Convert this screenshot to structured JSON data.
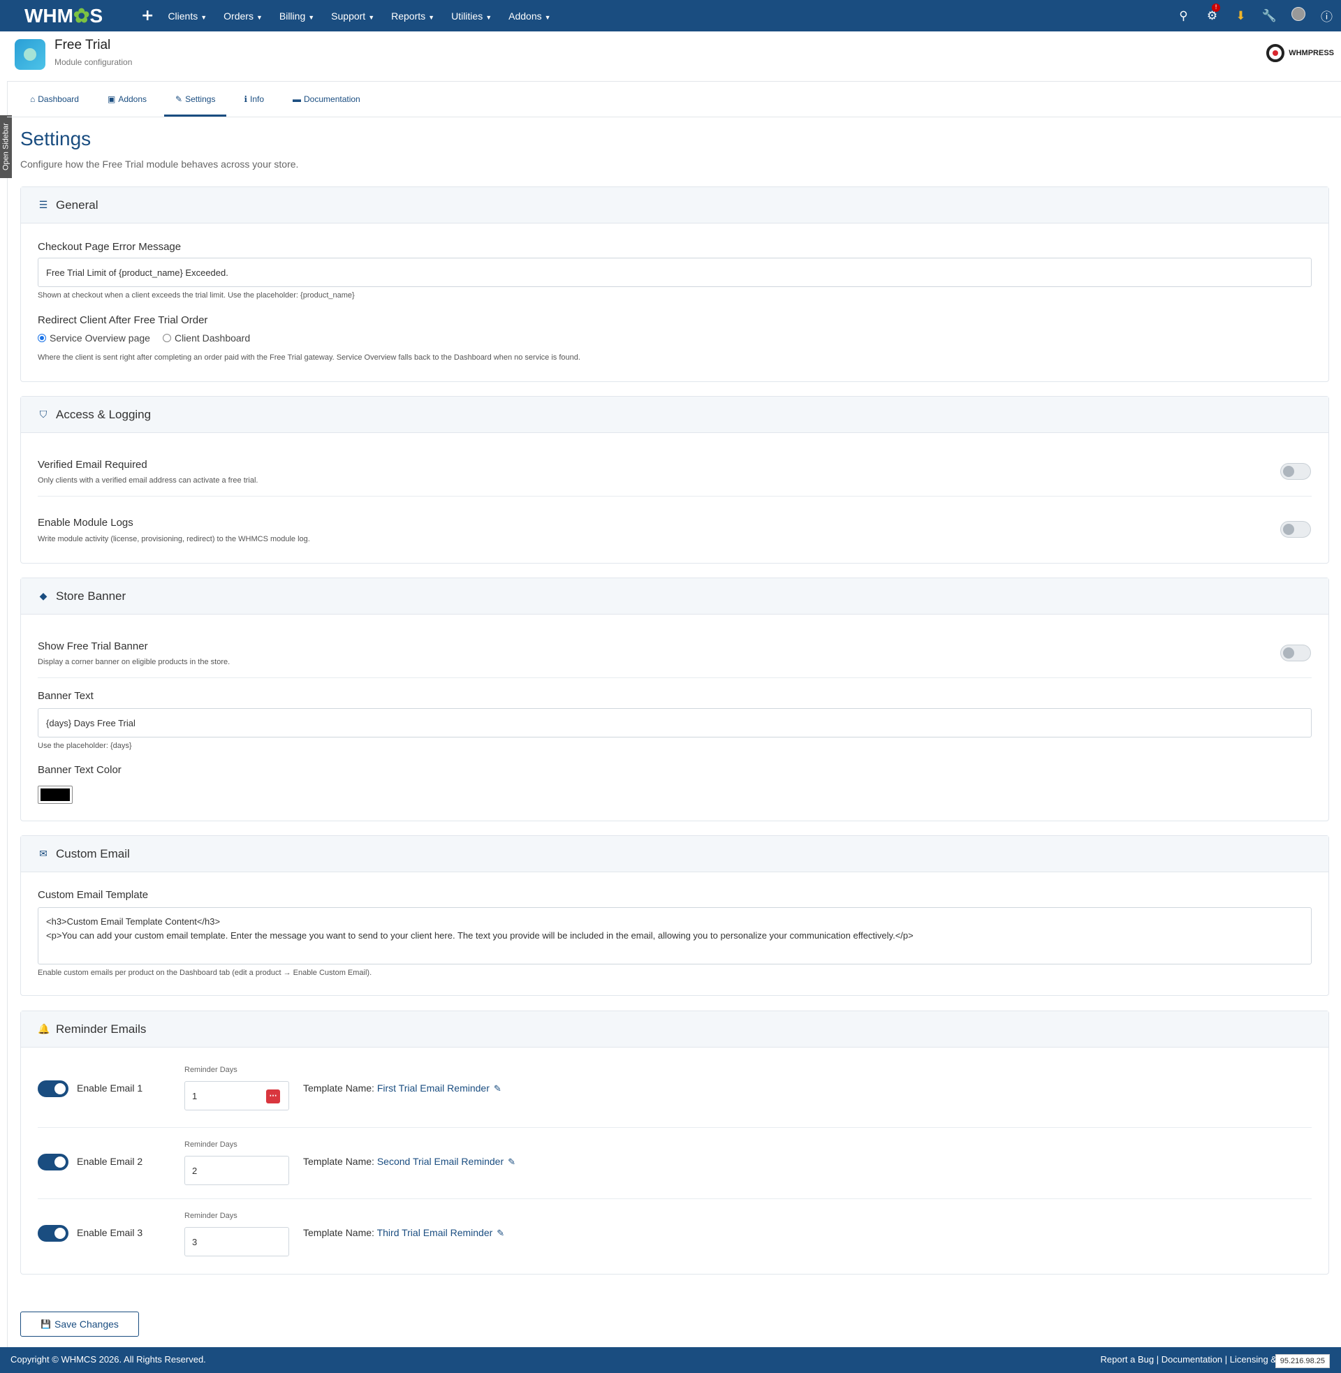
{
  "nav": {
    "logo": "WHMCS",
    "items": [
      "Clients",
      "Orders",
      "Billing",
      "Support",
      "Reports",
      "Utilities",
      "Addons"
    ],
    "badge": "!"
  },
  "module": {
    "title": "Free Trial",
    "subtitle": "Module configuration",
    "brand": "WHMPRESS"
  },
  "sidebar_toggle": "Open Sidebar",
  "tabs": [
    "Dashboard",
    "Addons",
    "Settings",
    "Info",
    "Documentation"
  ],
  "active_tab": "Settings",
  "page": {
    "title": "Settings",
    "subtitle": "Configure how the Free Trial module behaves across your store."
  },
  "general": {
    "heading": "General",
    "error_label": "Checkout Page Error Message",
    "error_value": "Free Trial Limit of {product_name} Exceeded.",
    "error_help": "Shown at checkout when a client exceeds the trial limit. Use the placeholder: {product_name}",
    "redirect_label": "Redirect Client After Free Trial Order",
    "redirect_options": [
      "Service Overview page",
      "Client Dashboard"
    ],
    "redirect_selected": "Service Overview page",
    "redirect_help": "Where the client is sent right after completing an order paid with the Free Trial gateway. Service Overview falls back to the Dashboard when no service is found."
  },
  "access": {
    "heading": "Access & Logging",
    "verified_label": "Verified Email Required",
    "verified_help": "Only clients with a verified email address can activate a free trial.",
    "verified_on": false,
    "logs_label": "Enable Module Logs",
    "logs_help": "Write module activity (license, provisioning, redirect) to the WHMCS module log.",
    "logs_on": false
  },
  "banner": {
    "heading": "Store Banner",
    "show_label": "Show Free Trial Banner",
    "show_help": "Display a corner banner on eligible products in the store.",
    "show_on": false,
    "text_label": "Banner Text",
    "text_value": "{days} Days Free Trial",
    "text_help": "Use the placeholder: {days}",
    "color_label": "Banner Text Color",
    "color_value": "#000000"
  },
  "custom_email": {
    "heading": "Custom Email",
    "template_label": "Custom Email Template",
    "template_line1": "<h3>Custom Email Template Content</h3>",
    "template_line2": "<p>You can add your custom email template. Enter the message you want to send to your client here. The text you provide will be included in the email, allowing you to personalize your communication effectively.</p>",
    "help": "Enable custom emails per product on the Dashboard tab (edit a product → Enable Custom Email)."
  },
  "reminders": {
    "heading": "Reminder Emails",
    "days_label": "Reminder Days",
    "template_prefix": "Template Name:",
    "items": [
      {
        "label": "Enable Email 1",
        "on": true,
        "days": "1",
        "template": "First Trial Email Reminder"
      },
      {
        "label": "Enable Email 2",
        "on": true,
        "days": "2",
        "template": "Second Trial Email Reminder"
      },
      {
        "label": "Enable Email 3",
        "on": true,
        "days": "3",
        "template": "Third Trial Email Reminder"
      }
    ]
  },
  "save_label": "Save Changes",
  "footer": {
    "copyright": "Copyright © WHMCS 2026. All Rights Reserved.",
    "links": "Report a Bug | Documentation | Licensing & Updates",
    "ip": "95.216.98.25"
  },
  "colors": {
    "primary": "#1a4d80",
    "accent_green": "#7cc242",
    "alert_red": "#d9363e"
  }
}
